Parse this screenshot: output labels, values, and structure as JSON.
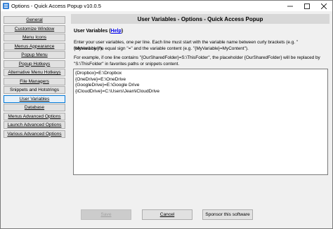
{
  "window": {
    "title": "Options - Quick Access Popup v10.0.5"
  },
  "sidebar": {
    "items": [
      {
        "label": "General"
      },
      {
        "label": "Customize Window"
      },
      {
        "label": "Menu Icons"
      },
      {
        "label": "Menus Appearance"
      },
      {
        "label": "Popup Menu"
      },
      {
        "label": "Popup Hotkeys"
      },
      {
        "label": "Alternative Menu Hotkeys"
      },
      {
        "label": "File Managers"
      },
      {
        "label": "Snippets and Hotstrings"
      },
      {
        "label": "User Variables",
        "selected": true
      },
      {
        "label": "Database"
      },
      {
        "label": "Menus Advanced Options"
      },
      {
        "label": "Launch Advanced Options"
      },
      {
        "label": "Various Advanced Options"
      }
    ]
  },
  "main": {
    "header": "User Variables - Options - Quick Access Popup",
    "section_label": "User Variables",
    "help_link": "Help",
    "description1_line1": "Enter your user variables, one per line. Each line must start with the variable name between curly brackets (e.g. \"{MyVariable}\"),",
    "description1_line2": "followed by the equal sign \"=\" and the variable content (e.g. \"{MyVariable}=MyContent\").",
    "description2_line1": "For example, if one line contains \"{OurSharedFolder}=S:\\ThisFolder\", the placeholder {OurSharedFolder} will be replaced by",
    "description2_line2": "\"S:\\ThisFolder\" in favorites paths or snippets content.",
    "variables": [
      "{Dropbox}=E:\\Dropbox",
      "{OneDrive}=E:\\OneDrive",
      "{GoogleDrive}=E:\\Google Drive",
      "{iCloudDrive}=C:\\Users\\Jean\\iCloudDrive"
    ]
  },
  "footer": {
    "save_label": "Save",
    "cancel_label": "Cancel",
    "sponsor_label": "Sponsor this software"
  }
}
